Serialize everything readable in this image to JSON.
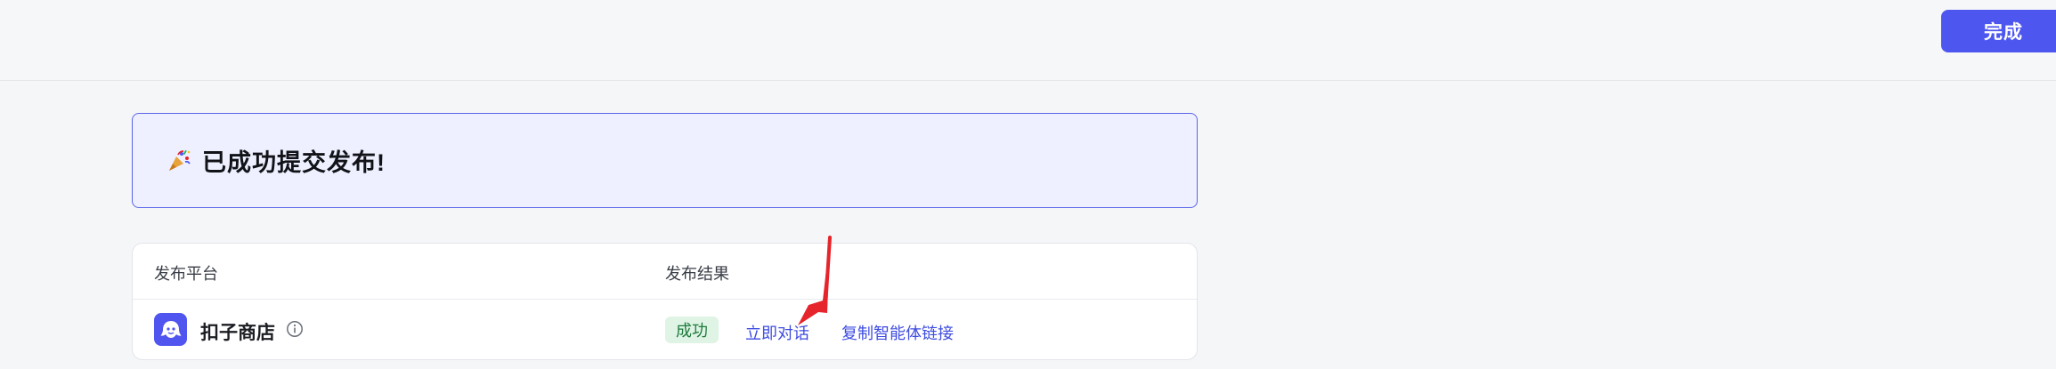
{
  "header": {
    "done_label": "完成"
  },
  "banner": {
    "icon": "party-popper-icon",
    "title": "已成功提交发布!"
  },
  "table": {
    "columns": [
      "发布平台",
      "发布结果"
    ],
    "rows": [
      {
        "platform_icon": "coze-logo-icon",
        "platform": "扣子商店",
        "status": "成功",
        "actions": [
          "立即对话",
          "复制智能体链接"
        ]
      }
    ]
  },
  "colors": {
    "accent": "#4e56f0",
    "banner_bg": "#eef0ff",
    "success_bg": "#dff4e5",
    "success_text": "#1f7a3d",
    "link": "#3e4ce0",
    "annotation_arrow": "#e5242b"
  }
}
